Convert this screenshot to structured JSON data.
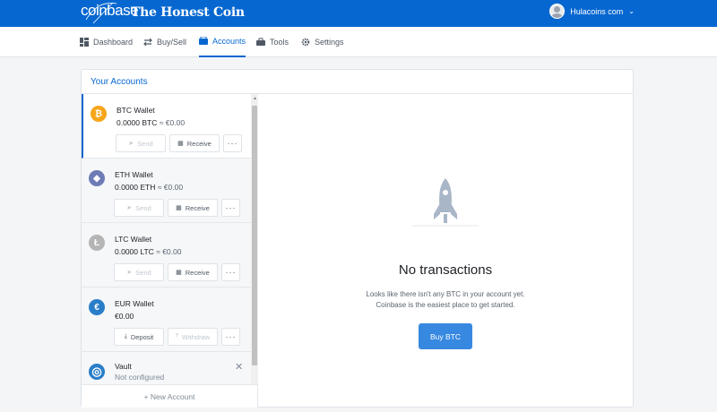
{
  "topbar": {
    "logo_text": "coinbase",
    "brand_title": "The Honest Coin",
    "user_name": "Hulacoins com",
    "chevron": "⌄"
  },
  "nav": [
    {
      "label": "Dashboard",
      "icon": "dashboard-icon",
      "active": false
    },
    {
      "label": "Buy/Sell",
      "icon": "buy-sell-icon",
      "active": false
    },
    {
      "label": "Accounts",
      "icon": "accounts-icon",
      "active": true
    },
    {
      "label": "Tools",
      "icon": "tools-icon",
      "active": false
    },
    {
      "label": "Settings",
      "icon": "settings-icon",
      "active": false
    }
  ],
  "accounts": {
    "title": "Your Accounts",
    "wallets": [
      {
        "name": "BTC Wallet",
        "balance": "0.0000 BTC",
        "approx": "≈ €0.00",
        "icon_char": "₿",
        "color": "#f7a51a",
        "btn1": "Send",
        "btn2": "Receive",
        "btn1_disabled": true,
        "btn2_disabled": false
      },
      {
        "name": "ETH Wallet",
        "balance": "0.0000 ETH",
        "approx": "≈ €0.00",
        "icon_char": "◆",
        "color": "#6e7cb6",
        "btn1": "Send",
        "btn2": "Receive",
        "btn1_disabled": true,
        "btn2_disabled": false
      },
      {
        "name": "LTC Wallet",
        "balance": "0.0000 LTC",
        "approx": "≈ €0.00",
        "icon_char": "Ł",
        "color": "#b5b5b5",
        "btn1": "Send",
        "btn2": "Receive",
        "btn1_disabled": true,
        "btn2_disabled": false
      },
      {
        "name": "EUR Wallet",
        "balance": "€0.00",
        "approx": "",
        "icon_char": "€",
        "color": "#2a7ec8",
        "btn1": "Deposit",
        "btn2": "Withdraw",
        "btn1_disabled": false,
        "btn2_disabled": true
      },
      {
        "name": "Vault",
        "balance": "Not configured",
        "approx": "",
        "icon_char": "◎",
        "color": "#2a7ec8"
      }
    ],
    "more_label": "···",
    "new_account": "+ New Account"
  },
  "empty_state": {
    "title": "No transactions",
    "line1": "Looks like there isn't any BTC in your account yet.",
    "line2": "Coinbase is the easiest place to get started.",
    "button": "Buy BTC"
  },
  "colors": {
    "brand": "#0667d0",
    "button": "#3788e0"
  }
}
